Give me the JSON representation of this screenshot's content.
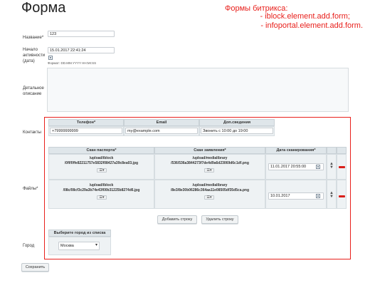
{
  "page": {
    "title": "Форма",
    "annotation": {
      "title": "Формы битрикса:",
      "line1": "- iblock.element.add.form;",
      "line2": "- infoportal.element.add.form."
    }
  },
  "fields": {
    "name": {
      "label": "Название*",
      "value": "123"
    },
    "active_from": {
      "label_1": "Начало",
      "label_2": "активности",
      "label_3": "(дата)",
      "value": "15.01.2017 22:41:24",
      "format_hint": "Формат: DD.MM.YYYY HH:MI:SS"
    },
    "description": {
      "label_1": "Детальное",
      "label_2": "описание"
    },
    "contacts": {
      "label": "Контакты",
      "headers": [
        "Телефон*",
        "Email",
        "Доп.сведения"
      ],
      "values": [
        "+79999999999",
        "my@example.com",
        "Звонить с 10:00 до 19:00"
      ]
    },
    "files": {
      "label": "Файлы*",
      "headers": [
        "Скан паспорта*",
        "Скан заявления*",
        "Дата сканирования*"
      ],
      "rows": [
        {
          "passport_1": "/upload/iblock",
          "passport_2": "/0ff/0ffe82211757e5832f08427a39c8ea03.jpg",
          "statement_1": "/upload/medialibrary",
          "statement_2": "/536/536a3844273f7de4d9a6d23069d6c1df.png",
          "date": "11.01.2017 20:55:00"
        },
        {
          "passport_1": "/upload/iblock",
          "passport_2": "/08c/08cf3c29a3b74e43f00b31225b8274d6.jpg",
          "statement_1": "/upload/medialibrary",
          "statement_2": "/8e3/8e30b06286c364aa11e08505df35d5ca.png",
          "date": "10.01.2017"
        }
      ],
      "add_row": "Добавить строку",
      "delete_row": "Удалить строку"
    },
    "city": {
      "label": "Город",
      "header": "Выберите город из списка",
      "selected": "Москва"
    }
  },
  "actions": {
    "save": "Сохранить"
  }
}
